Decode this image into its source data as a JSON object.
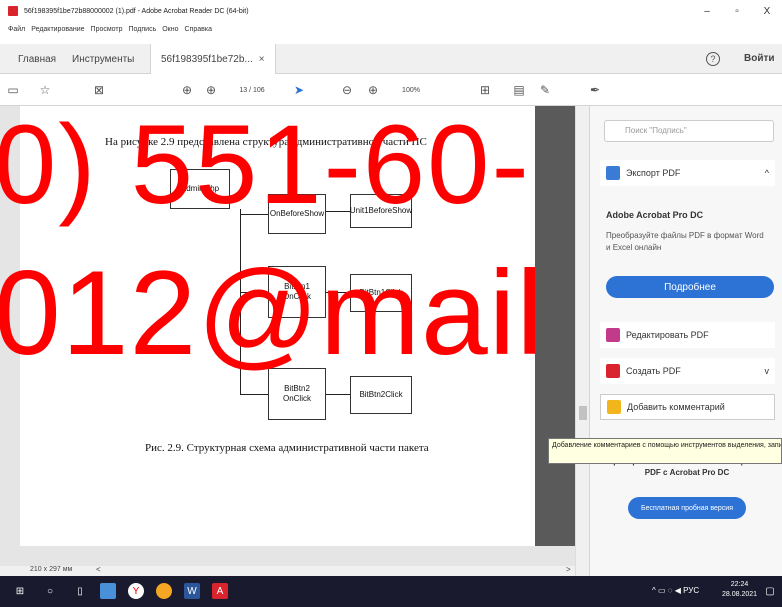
{
  "window": {
    "title": "56f198395f1be72b88000002 (1).pdf - Adobe Acrobat Reader DC (64-bit)",
    "minimize": "–",
    "maximize": "▫",
    "close": "X"
  },
  "menu": [
    "Файл",
    "Редактирование",
    "Просмотр",
    "Подпись",
    "Окно",
    "Справка"
  ],
  "tabs": {
    "home": "Главная",
    "tools": "Инструменты",
    "doc": "56f198395f1be72b...",
    "doc_close": "×"
  },
  "header": {
    "help": "?",
    "login": "Войти"
  },
  "toolbar": {
    "page_of": "13 / 106",
    "zoom": "100%"
  },
  "document": {
    "caption_top": "На рисунке 2.9 представлена структура административной части ПС",
    "nodes": {
      "admin": "Admin.php",
      "onbeforeshow": "OnBeforeShow",
      "unit1": "Unit1BeforeShow",
      "bitbtn1": "BitBtn1 OnClick",
      "bitbtn1click": "BitBtn1Click",
      "bitbtn2": "BitBtn2 OnClick",
      "bitbtn2click": "BitBtn2Click"
    },
    "caption_bottom": "Рис. 2.9. Структурная схема административной части пакета"
  },
  "status": {
    "page_size": "210 x 297 мм",
    "left": "<",
    "right": ">"
  },
  "panel": {
    "search_placeholder": "Поиск \"Подпись\"",
    "export_pdf": "Экспорт PDF",
    "promo_title": "Adobe Acrobat Pro DC",
    "promo_text": "Преобразуйте файлы PDF в формат Word и Excel онлайн",
    "more_button": "Подробнее",
    "edit_pdf": "Редактировать PDF",
    "create_pdf": "Создать PDF",
    "add_comment": "Добавить комментарий",
    "tooltip": "Добавление комментариев с помощью инструментов выделения, записок и средств произвольного рисования",
    "convert_text": "Преобразовывайте и изменяйте файлы PDF с Acrobat Pro DC",
    "trial_button": "Бесплатная пробная версия"
  },
  "taskbar": {
    "lang": "РУС",
    "time": "22:24",
    "date": "28.08.2021"
  },
  "watermark": {
    "line1": "0) 551-60-",
    "line2": "012@mail"
  },
  "colors": {
    "accent": "#2d73d6",
    "watermark": "#ff0000",
    "acrobat_red": "#d9232d"
  }
}
